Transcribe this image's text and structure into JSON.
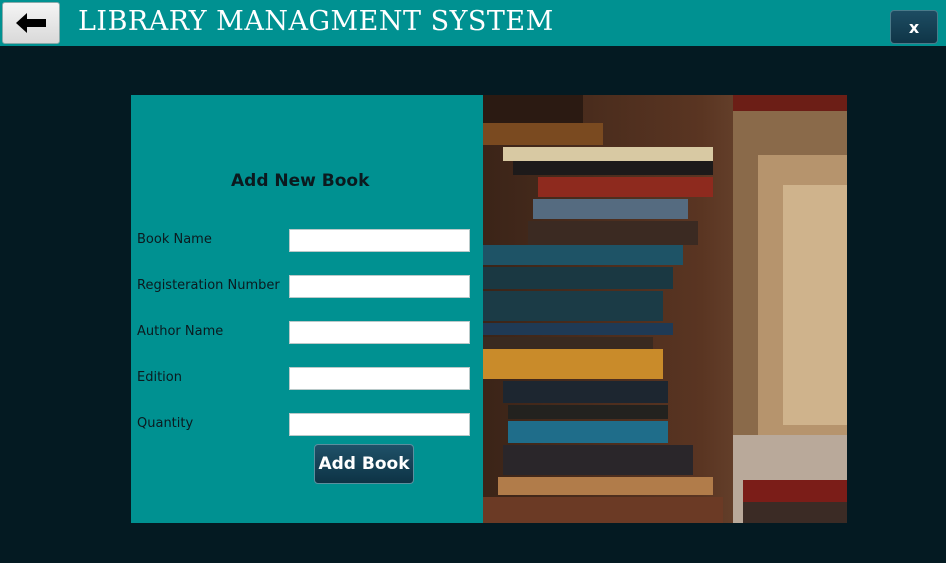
{
  "header": {
    "title": "LIBRARY MANAGMENT SYSTEM",
    "close_label": "x"
  },
  "form": {
    "title": "Add New Book",
    "fields": [
      {
        "label": "Book Name",
        "value": ""
      },
      {
        "label": "Registeration Number",
        "value": ""
      },
      {
        "label": "Author Name",
        "value": ""
      },
      {
        "label": "Edition",
        "value": ""
      },
      {
        "label": "Quantity",
        "value": ""
      }
    ],
    "submit_label": "Add Book"
  },
  "colors": {
    "teal": "#009191",
    "background": "#041a22",
    "button_dark": "#0f3547"
  },
  "icons": {
    "back": "arrow-left-icon"
  }
}
